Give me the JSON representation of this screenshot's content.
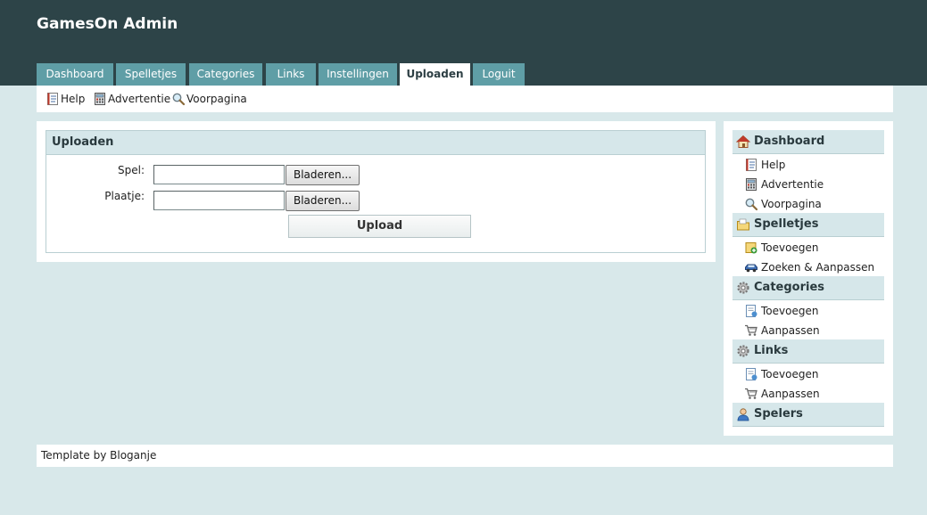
{
  "site": {
    "title": "GamesOn Admin"
  },
  "tabs": [
    {
      "label": "Dashboard"
    },
    {
      "label": "Spelletjes"
    },
    {
      "label": "Categories"
    },
    {
      "label": "Links"
    },
    {
      "label": "Instellingen"
    },
    {
      "label": "Uploaden",
      "active": true
    },
    {
      "label": "Loguit"
    }
  ],
  "subnav": [
    {
      "label": "Help",
      "icon": "help-doc-icon"
    },
    {
      "label": "Advertentie",
      "icon": "calculator-icon"
    },
    {
      "label": "Voorpagina",
      "icon": "magnifier-icon"
    }
  ],
  "upload": {
    "title": "Uploaden",
    "game_label": "Spel:",
    "image_label": "Plaatje:",
    "browse_label": "Bladeren...",
    "submit_label": "Upload"
  },
  "sidebar": {
    "dashboard": {
      "title": "Dashboard",
      "items": [
        {
          "label": "Help"
        },
        {
          "label": "Advertentie"
        },
        {
          "label": "Voorpagina"
        }
      ]
    },
    "spelletjes": {
      "title": "Spelletjes",
      "items": [
        {
          "label": "Toevoegen"
        },
        {
          "label": "Zoeken & Aanpassen"
        }
      ]
    },
    "categories": {
      "title": "Categories",
      "items": [
        {
          "label": "Toevoegen"
        },
        {
          "label": "Aanpassen"
        }
      ]
    },
    "links": {
      "title": "Links",
      "items": [
        {
          "label": "Toevoegen"
        },
        {
          "label": "Aanpassen"
        }
      ]
    },
    "spelers": {
      "title": "Spelers"
    }
  },
  "footer": {
    "prefix": "Template",
    "by": "by",
    "author": "Bloganje"
  },
  "colors": {
    "header": "#2d4448",
    "tab": "#5f9ea6",
    "background": "#d8e8ea",
    "panel_head": "#d6e7ea"
  }
}
